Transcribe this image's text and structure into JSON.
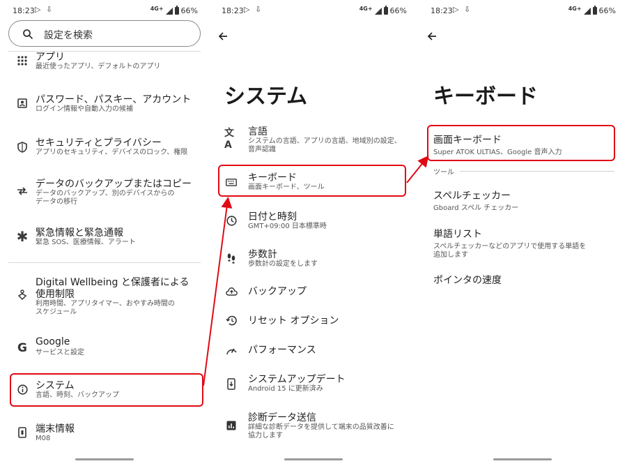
{
  "status": {
    "time": "18:23",
    "network": "4G+",
    "battery": "66%"
  },
  "panel1": {
    "search_placeholder": "設定を検索",
    "items": [
      {
        "icon": "apps-icon",
        "title": "アプリ",
        "subtitle": "最近使ったアプリ、デフォルトのアプリ"
      },
      {
        "icon": "account-box-icon",
        "title": "パスワード、パスキー、アカウント",
        "subtitle": "ログイン情報や自動入力の候補"
      },
      {
        "icon": "shield-icon",
        "title": "セキュリティとプライバシー",
        "subtitle": "アプリのセキュリティ、デバイスのロック、権限"
      },
      {
        "icon": "transfer-icon",
        "title": "データのバックアップまたはコピー",
        "subtitle1": "データのバックアップ、別のデバイスからの",
        "subtitle2": "データの移行"
      },
      {
        "icon": "asterisk-icon",
        "title": "緊急情報と緊急通報",
        "subtitle": "緊急 SOS、医療情報、アラート"
      },
      {
        "icon": "wellbeing-icon",
        "title1": "Digital Wellbeing と保護者による",
        "title2": "使用制限",
        "subtitle1": "利用時間、アプリタイマー、おやすみ時間の",
        "subtitle2": "スケジュール"
      },
      {
        "icon": "google-icon",
        "title": "Google",
        "subtitle": "サービスと設定"
      },
      {
        "icon": "info-icon",
        "title": "システム",
        "subtitle": "言語、時刻、バックアップ"
      },
      {
        "icon": "phone-icon",
        "title": "端末情報",
        "subtitle": "M08"
      }
    ]
  },
  "panel2": {
    "title": "システム",
    "items": [
      {
        "icon": "translate-icon",
        "title": "言語",
        "subtitle1": "システムの言語、アプリの言語、地域別の設定、",
        "subtitle2": "音声認識"
      },
      {
        "icon": "keyboard-icon",
        "title": "キーボード",
        "subtitle": "画面キーボード、ツール"
      },
      {
        "icon": "clock-icon",
        "title": "日付と時刻",
        "subtitle": "GMT+09:00 日本標準時"
      },
      {
        "icon": "footsteps-icon",
        "title": "歩数計",
        "subtitle": "歩数計の設定をします"
      },
      {
        "icon": "cloud-upload-icon",
        "title": "バックアップ"
      },
      {
        "icon": "history-icon",
        "title": "リセット オプション"
      },
      {
        "icon": "speed-icon",
        "title": "パフォーマンス"
      },
      {
        "icon": "system-update-icon",
        "title": "システムアップデート",
        "subtitle": "Android 15 に更新済み"
      },
      {
        "icon": "chart-icon",
        "title": "診断データ送信",
        "subtitle1": "詳細な診断データを提供して端末の品質改善に",
        "subtitle2": "協力します"
      }
    ]
  },
  "panel3": {
    "title": "キーボード",
    "items": [
      {
        "title": "画面キーボード",
        "subtitle": "Super ATOK ULTIAS、Google 音声入力"
      },
      {
        "title": "スペルチェッカー",
        "subtitle": "Gboard スペル チェッカー"
      },
      {
        "title": "単語リスト",
        "subtitle1": "スペルチェッカーなどのアプリで使用する単語を",
        "subtitle2": "追加します"
      },
      {
        "title": "ポインタの速度"
      }
    ],
    "category": "ツール"
  },
  "colors": {
    "highlight": "#e00a14",
    "text": "#1f1f1f",
    "subtext": "#555555"
  }
}
